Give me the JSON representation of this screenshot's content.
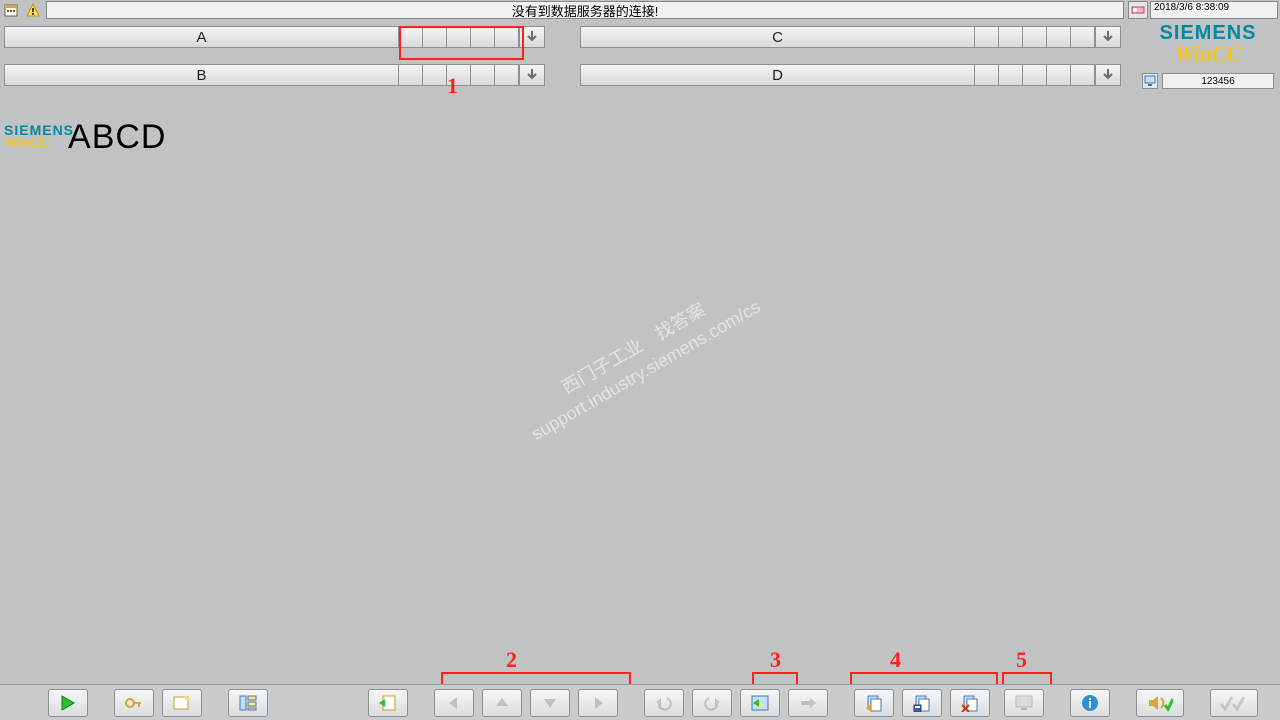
{
  "topbar": {
    "status_message": "没有到数据服务器的连接!",
    "timestamp": "2018/3/6 8:38:09"
  },
  "combos": {
    "a": "A",
    "b": "B",
    "c": "C",
    "d": "D"
  },
  "brand": {
    "siemens": "SIEMENS",
    "wincc": "WinCC",
    "id_value": "123456"
  },
  "midmark": {
    "siemens": "SIEMENS",
    "wincc": "WinCC",
    "text": "ABCD"
  },
  "watermark": {
    "line1": "西门子工业　找答案",
    "line2": "support.industry.siemens.com/cs"
  },
  "annotations": {
    "n1": "1",
    "n2": "2",
    "n3": "3",
    "n4": "4",
    "n5": "5"
  }
}
